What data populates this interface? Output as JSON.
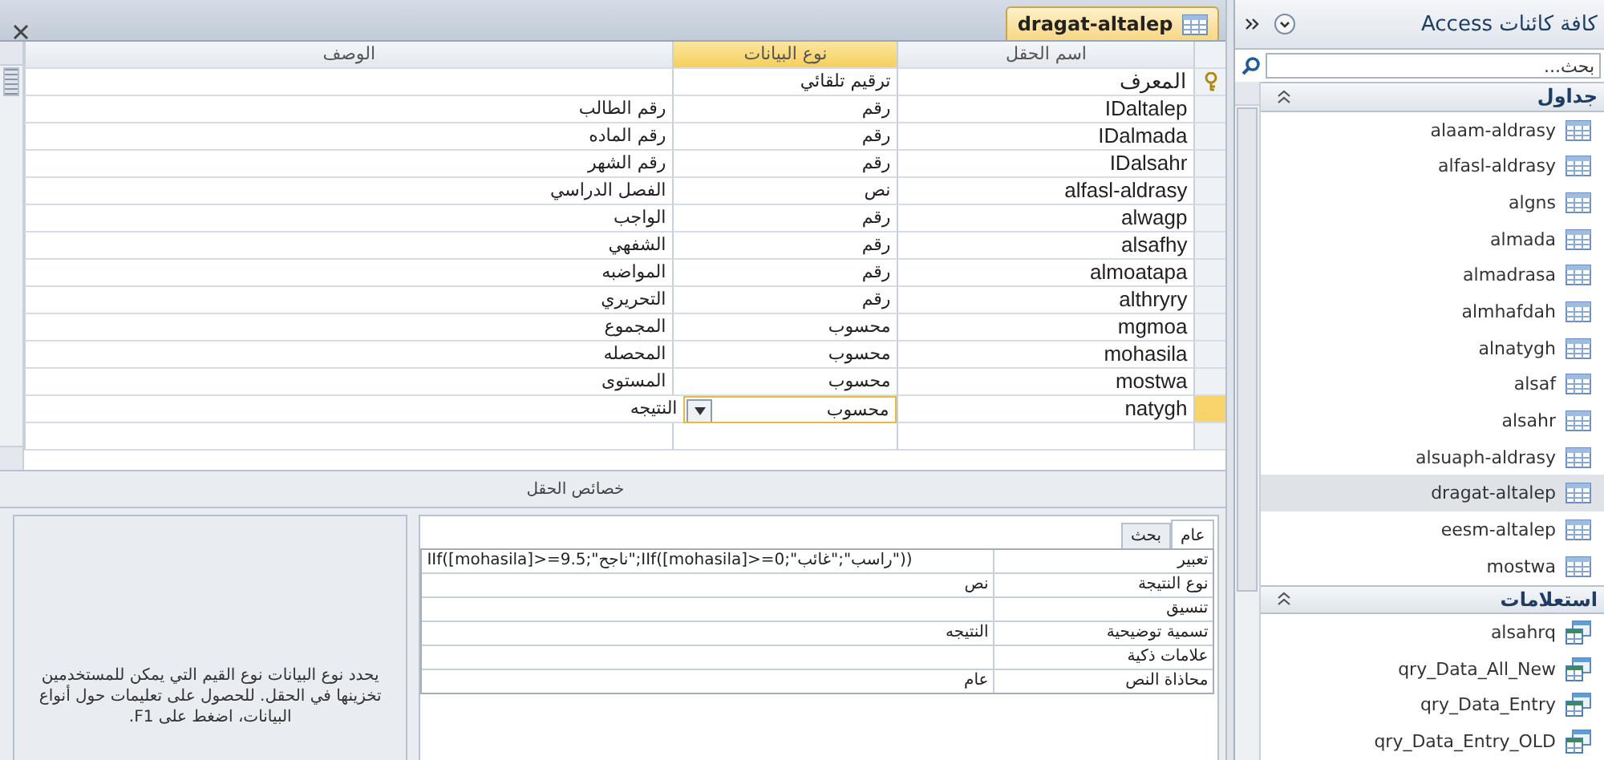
{
  "document_tab": {
    "title": "dragat-altalep",
    "selected": true
  },
  "grid": {
    "columns": [
      {
        "label": "اسم الحقل",
        "selected": false
      },
      {
        "label": "نوع البيانات",
        "selected": true
      },
      {
        "label": "الوصف",
        "selected": false
      }
    ],
    "rows": [
      {
        "name": "المعرف",
        "type": "ترقيم تلقائي",
        "primary_key": true,
        "selected": false
      },
      {
        "name": "IDaltalep",
        "type": "رقم",
        "description": "رقم الطالب",
        "primary_key": false,
        "selected": false
      },
      {
        "name": "IDalmada",
        "type": "رقم",
        "description": "رقم الماده",
        "primary_key": false,
        "selected": false
      },
      {
        "name": "IDalsahr",
        "type": "رقم",
        "description": "رقم الشهر",
        "primary_key": false,
        "selected": false
      },
      {
        "name": "alfasl-aldrasy",
        "type": "نص",
        "description": "الفصل الدراسي",
        "primary_key": false,
        "selected": false
      },
      {
        "name": "alwagp",
        "type": "رقم",
        "description": "الواجب",
        "primary_key": false,
        "selected": false
      },
      {
        "name": "alsafhy",
        "type": "رقم",
        "description": "الشفهي",
        "primary_key": false,
        "selected": false
      },
      {
        "name": "almoatapa",
        "type": "رقم",
        "description": "المواضبه",
        "primary_key": false,
        "selected": false
      },
      {
        "name": "althryry",
        "type": "رقم",
        "description": "التحريري",
        "primary_key": false,
        "selected": false
      },
      {
        "name": "mgmoa",
        "type": "محسوب",
        "description": "المجموع",
        "primary_key": false,
        "selected": false
      },
      {
        "name": "mohasila",
        "type": "محسوب",
        "description": "المحصله",
        "primary_key": false,
        "selected": false
      },
      {
        "name": "mostwa",
        "type": "محسوب",
        "description": "المستوى",
        "primary_key": false,
        "selected": false
      },
      {
        "name": "natygh",
        "type": "محسوب",
        "description": "النتيجه",
        "primary_key": false,
        "selected": true
      }
    ]
  },
  "field_properties": {
    "title": "خصائص الحقل",
    "tabs": [
      {
        "label": "عام",
        "selected": true
      },
      {
        "label": "بحث",
        "selected": false
      }
    ],
    "properties": [
      {
        "label": "تعبير",
        "value": "IIf([mohasila]>=9.5;\"ناجح\";IIf([mohasila]>=0;\"راسب\";\"غائب\"))",
        "kind": "ltr"
      },
      {
        "label": "نوع النتيجة",
        "value": "نص",
        "kind": "rtl"
      },
      {
        "label": "تنسيق",
        "kind": "rtl"
      },
      {
        "label": "تسمية توضيحية",
        "value": "النتيجه",
        "kind": "rtl"
      },
      {
        "label": "علامات ذكية",
        "kind": "rtl"
      },
      {
        "label": "محاذاة النص",
        "value": "عام",
        "kind": "rtl"
      }
    ],
    "help": "يحدد نوع البيانات نوع القيم التي يمكن للمستخدمين تخزينها في الحقل. للحصول على تعليمات حول أنواع البيانات، اضغط على F1."
  },
  "navigation_pane": {
    "title": "كافة كائنات Access",
    "search": {
      "placeholder": "بحث..."
    },
    "groups": [
      {
        "title": "جداول",
        "kind": "table",
        "items": [
          {
            "label": "alaam-aldrasy",
            "selected": false
          },
          {
            "label": "alfasl-aldrasy",
            "selected": false
          },
          {
            "label": "algns",
            "selected": false
          },
          {
            "label": "almada",
            "selected": false
          },
          {
            "label": "almadrasa",
            "selected": false
          },
          {
            "label": "almhafdah",
            "selected": false
          },
          {
            "label": "alnatygh",
            "selected": false
          },
          {
            "label": "alsaf",
            "selected": false
          },
          {
            "label": "alsahr",
            "selected": false
          },
          {
            "label": "alsuaph-aldrasy",
            "selected": false
          },
          {
            "label": "dragat-altalep",
            "selected": true
          },
          {
            "label": "eesm-altalep",
            "selected": false
          },
          {
            "label": "mostwa",
            "selected": false
          }
        ]
      },
      {
        "title": "استعلامات",
        "kind": "query",
        "items": [
          {
            "label": "alsahrq",
            "selected": false
          },
          {
            "label": "qry_Data_All_New",
            "selected": false
          },
          {
            "label": "qry_Data_Entry",
            "selected": false
          },
          {
            "label": "qry_Data_Entry_OLD",
            "selected": false
          }
        ]
      }
    ]
  }
}
